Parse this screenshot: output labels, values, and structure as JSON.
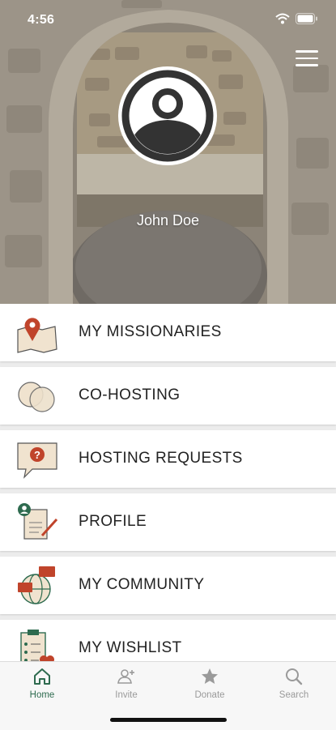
{
  "status_bar": {
    "time": "4:56"
  },
  "hero": {
    "user_name": "John Doe"
  },
  "menu": {
    "items": [
      {
        "label": "MY MISSIONARIES",
        "icon": "map-pin-icon"
      },
      {
        "label": "CO-HOSTING",
        "icon": "overlapping-circles-icon"
      },
      {
        "label": "HOSTING REQUESTS",
        "icon": "question-chat-icon"
      },
      {
        "label": "PROFILE",
        "icon": "profile-document-icon"
      },
      {
        "label": "MY COMMUNITY",
        "icon": "globe-chat-icon"
      },
      {
        "label": "MY WISHLIST",
        "icon": "wishlist-clipboard-icon"
      }
    ]
  },
  "tabbar": {
    "tabs": [
      {
        "label": "Home",
        "icon": "home-icon",
        "active": true
      },
      {
        "label": "Invite",
        "icon": "add-person-icon",
        "active": false
      },
      {
        "label": "Donate",
        "icon": "star-icon",
        "active": false
      },
      {
        "label": "Search",
        "icon": "search-icon",
        "active": false
      }
    ]
  },
  "colors": {
    "accent": "#2e6b4f",
    "icon_red": "#c0442b",
    "icon_beige": "#f0e3cf",
    "inactive_tab": "#9a9a9a"
  }
}
